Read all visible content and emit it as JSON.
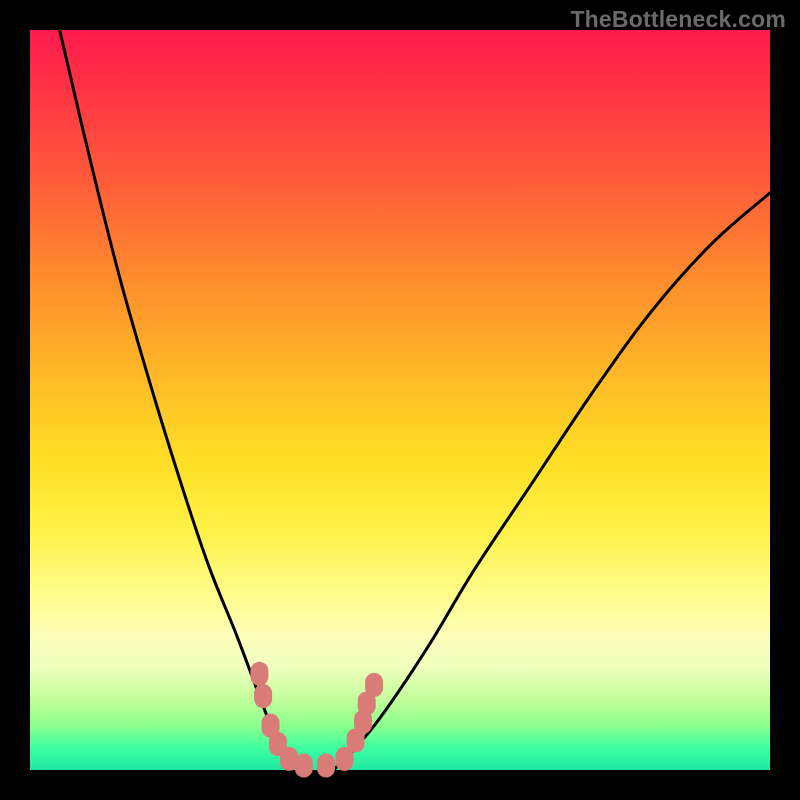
{
  "watermark": "TheBottleneck.com",
  "background": {
    "frame_color": "#000000",
    "gradient_stops": [
      {
        "pct": 0,
        "color": "#ff1a4d"
      },
      {
        "pct": 8,
        "color": "#ff3344"
      },
      {
        "pct": 20,
        "color": "#ff5a3a"
      },
      {
        "pct": 33,
        "color": "#ff8a2e"
      },
      {
        "pct": 46,
        "color": "#ffb727"
      },
      {
        "pct": 58,
        "color": "#ffde24"
      },
      {
        "pct": 68,
        "color": "#fff24a"
      },
      {
        "pct": 76,
        "color": "#fffc8a"
      },
      {
        "pct": 82,
        "color": "#fdffba"
      },
      {
        "pct": 86,
        "color": "#f0ffbf"
      },
      {
        "pct": 90,
        "color": "#c8ff9e"
      },
      {
        "pct": 94,
        "color": "#8cff8c"
      },
      {
        "pct": 97,
        "color": "#3effa0"
      },
      {
        "pct": 100,
        "color": "#1fe9a3"
      }
    ]
  },
  "chart_data": {
    "type": "line",
    "title": "",
    "xlabel": "",
    "ylabel": "",
    "x_range": [
      0,
      100
    ],
    "y_range": [
      0,
      100
    ],
    "note": "Axes unlabeled; values are relative 0–100. Two smooth curves forming a V shape with minimum near x≈37 at y≈0, plus scattered salmon markers clustered near the bottom of the V.",
    "series": [
      {
        "name": "left_curve",
        "x": [
          4,
          8,
          12,
          16,
          20,
          24,
          28,
          31,
          33,
          35,
          37
        ],
        "y": [
          100,
          83,
          67,
          53,
          40,
          28,
          18,
          10,
          5,
          2,
          0
        ]
      },
      {
        "name": "right_curve",
        "x": [
          41,
          44,
          48,
          54,
          60,
          68,
          76,
          84,
          92,
          100
        ],
        "y": [
          0,
          3,
          8,
          17,
          27,
          39,
          51,
          62,
          71,
          78
        ]
      }
    ],
    "markers": {
      "color": "#d97b77",
      "shape": "rounded-rect",
      "points_relative": [
        {
          "x": 31.0,
          "y": 13.0
        },
        {
          "x": 31.5,
          "y": 10.0
        },
        {
          "x": 32.5,
          "y": 6.0
        },
        {
          "x": 33.5,
          "y": 3.5
        },
        {
          "x": 35.0,
          "y": 1.5
        },
        {
          "x": 37.0,
          "y": 0.6
        },
        {
          "x": 40.0,
          "y": 0.6
        },
        {
          "x": 42.5,
          "y": 1.5
        },
        {
          "x": 44.0,
          "y": 4.0
        },
        {
          "x": 45.0,
          "y": 6.5
        },
        {
          "x": 45.5,
          "y": 9.0
        },
        {
          "x": 46.5,
          "y": 11.5
        }
      ]
    }
  }
}
